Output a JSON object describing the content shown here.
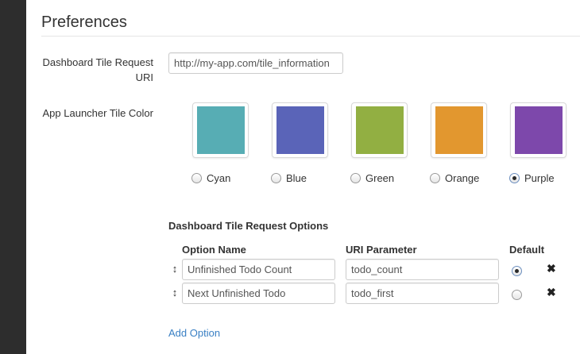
{
  "page": {
    "title": "Preferences"
  },
  "tile_uri": {
    "label": "Dashboard Tile Request URI",
    "value": "http://my-app.com/tile_information"
  },
  "launcher_color": {
    "label": "App Launcher Tile Color",
    "options": [
      {
        "label": "Cyan",
        "color": "#57adb4",
        "checked": false
      },
      {
        "label": "Blue",
        "color": "#5a64b8",
        "checked": false
      },
      {
        "label": "Green",
        "color": "#92af42",
        "checked": false
      },
      {
        "label": "Orange",
        "color": "#e2972f",
        "checked": false
      },
      {
        "label": "Purple",
        "color": "#7d48ab",
        "checked": true
      }
    ]
  },
  "request_options": {
    "heading": "Dashboard Tile Request Options",
    "columns": {
      "name": "Option Name",
      "param": "URI Parameter",
      "default": "Default"
    },
    "rows": [
      {
        "name": "Unfinished Todo Count",
        "param": "todo_count",
        "default": true,
        "handle_icon": "drag-handle-icon",
        "remove_icon": "close-icon"
      },
      {
        "name": "Next Unfinished Todo",
        "param": "todo_first",
        "default": false,
        "handle_icon": "drag-handle-icon",
        "remove_icon": "close-icon"
      }
    ],
    "add_label": "Add Option"
  },
  "colors": {
    "sidebar": "#2d2d2d",
    "link": "#3a80c4"
  }
}
